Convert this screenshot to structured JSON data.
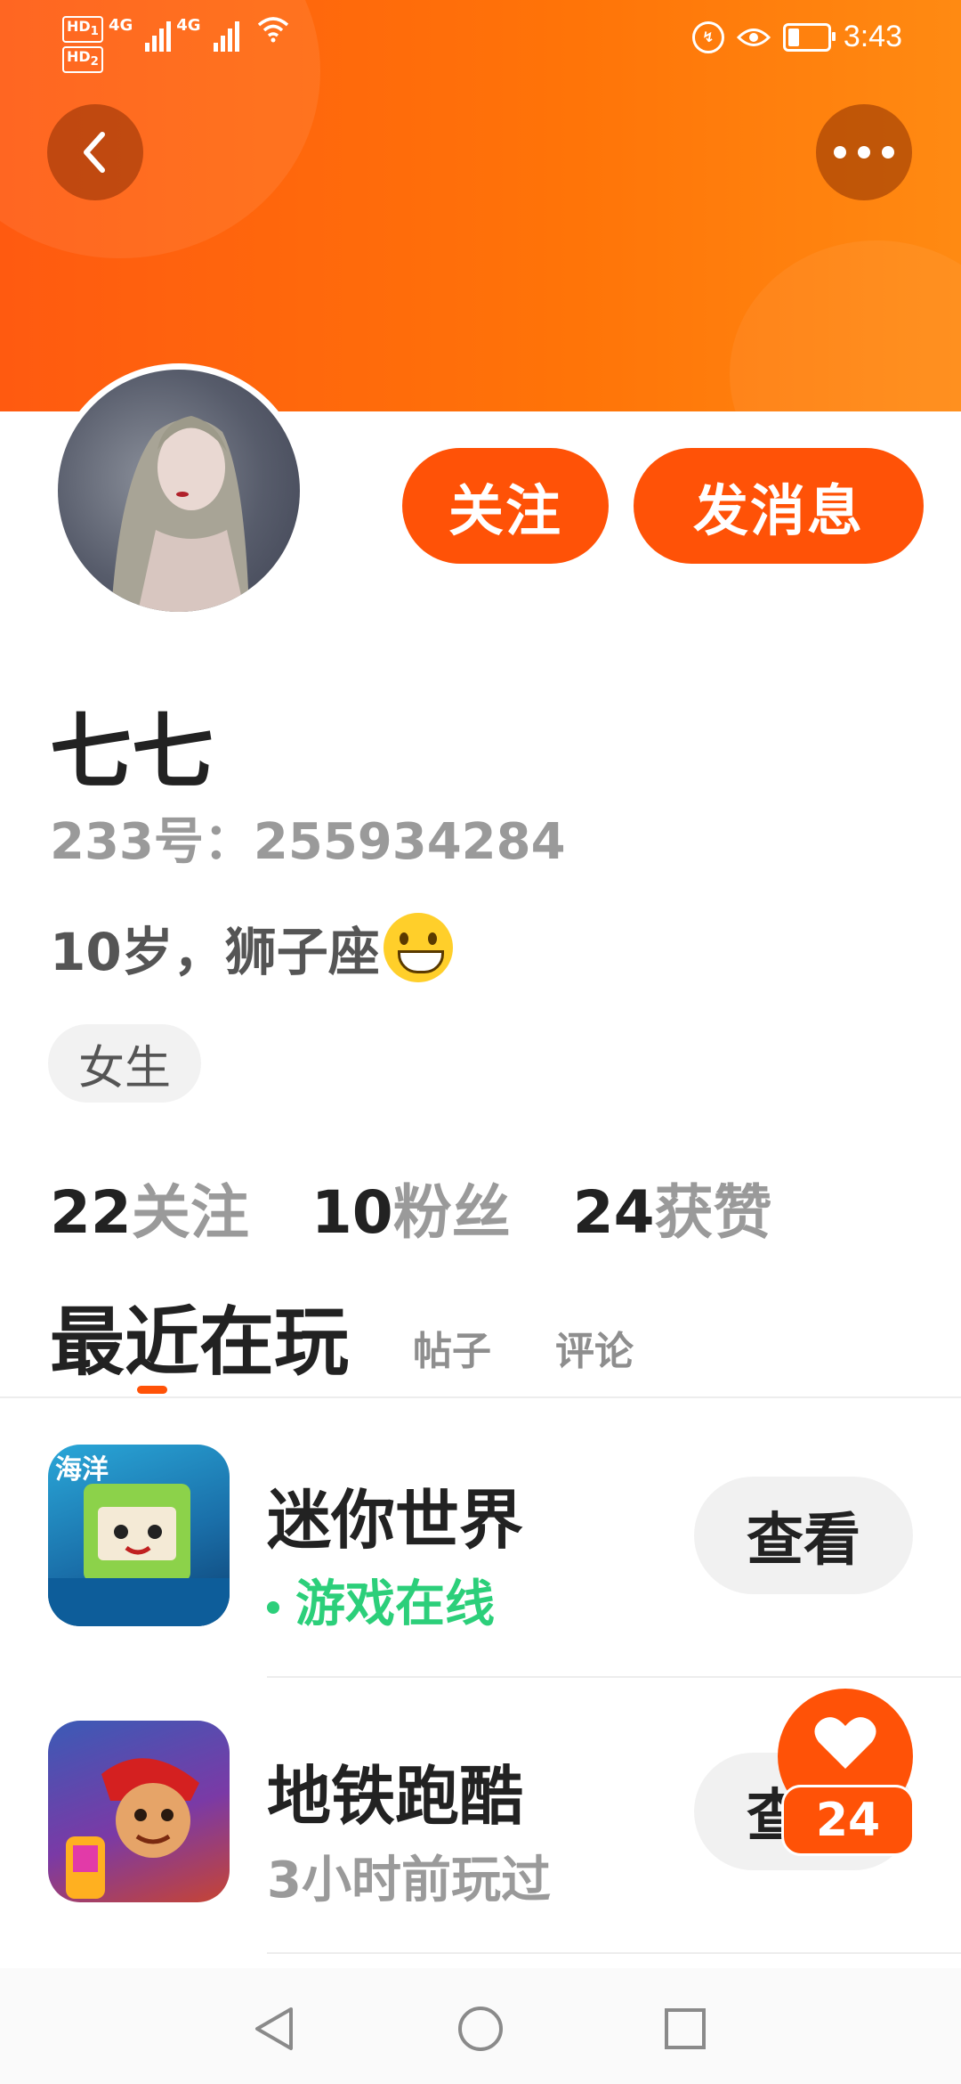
{
  "status_bar": {
    "network_1": "HD",
    "network_1_sub": "1",
    "network_2": "HD",
    "network_2_sub": "2",
    "signal_1": "4G",
    "signal_2": "4G",
    "time": "3:43"
  },
  "profile": {
    "follow_label": "关注",
    "message_label": "发消息",
    "name": "七七",
    "uid": "233号：255934284",
    "bio": "10岁，狮子座",
    "gender": "女生"
  },
  "stats": [
    {
      "count": "22",
      "label": "关注"
    },
    {
      "count": "10",
      "label": "粉丝"
    },
    {
      "count": "24",
      "label": "获赞"
    }
  ],
  "tabs": {
    "active": "最近在玩",
    "posts": "帖子",
    "comments": "评论"
  },
  "games": [
    {
      "title": "迷你世界",
      "status": "游戏在线",
      "view_label": "查看",
      "badge": "海洋"
    },
    {
      "title": "地铁跑酷",
      "status": "3小时前玩过",
      "view_label": "查看"
    }
  ],
  "like_fab": {
    "count": "24"
  },
  "colors": {
    "accent": "#ff5207",
    "online": "#2ccf7a"
  },
  "icons": {
    "back": "back-arrow-icon",
    "more": "more-dots-icon",
    "like": "heart-icon"
  }
}
